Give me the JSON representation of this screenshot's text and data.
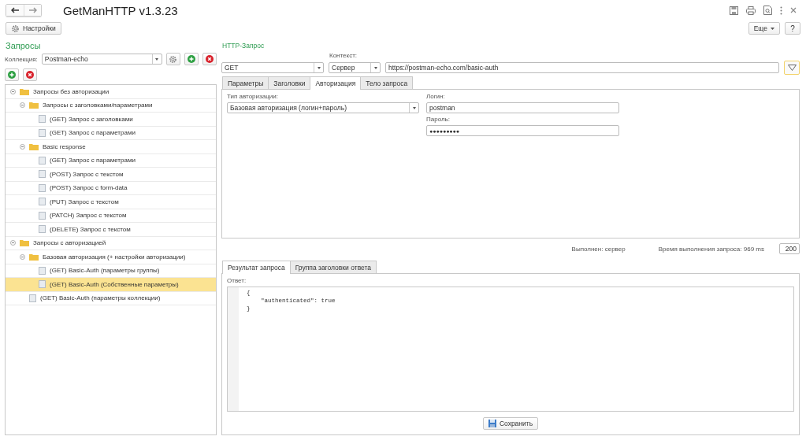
{
  "window": {
    "title": "GetManHTTP v1.3.23"
  },
  "toolbar": {
    "settings_button": "Настройки",
    "more_button": "Еще",
    "help_button": "?"
  },
  "left": {
    "title": "Запросы",
    "collection_label": "Коллекция:",
    "collection_value": "Postman-echo",
    "tree": [
      {
        "kind": "folder",
        "label": "Запросы без авторизации",
        "expanded": true,
        "selected": false,
        "children": [
          {
            "kind": "folder",
            "label": "Запросы с заголовками/параметрами",
            "expanded": true,
            "selected": false,
            "children": [
              {
                "kind": "request",
                "label": "(GET) Запрос с заголовками",
                "selected": false
              },
              {
                "kind": "request",
                "label": "(GET) Запрос с параметрами",
                "selected": false
              }
            ]
          },
          {
            "kind": "folder",
            "label": "Basic response",
            "expanded": true,
            "selected": false,
            "children": [
              {
                "kind": "request",
                "label": "(GET) Запрос с параметрами",
                "selected": false
              },
              {
                "kind": "request",
                "label": "(POST) Запрос с текстом",
                "selected": false
              },
              {
                "kind": "request",
                "label": "(POST) Запрос с form-data",
                "selected": false
              },
              {
                "kind": "request",
                "label": "(PUT) Запрос с текстом",
                "selected": false
              },
              {
                "kind": "request",
                "label": "(PATCH) Запрос с текстом",
                "selected": false
              },
              {
                "kind": "request",
                "label": "(DELETE) Запрос с текстом",
                "selected": false
              }
            ]
          }
        ]
      },
      {
        "kind": "folder",
        "label": "Запросы с авторизацией",
        "expanded": true,
        "selected": false,
        "children": [
          {
            "kind": "folder",
            "label": "Базовая авторизация (+ настройки авторизации)",
            "expanded": true,
            "selected": false,
            "children": [
              {
                "kind": "request",
                "label": "(GET) Basic-Auth (параметры группы)",
                "selected": false
              },
              {
                "kind": "request",
                "label": "(GET) Basic-Auth (Собственные параметры)",
                "selected": true
              }
            ]
          },
          {
            "kind": "request",
            "label": "(GET) Basic-Auth (параметры коллекции)",
            "selected": false
          }
        ]
      }
    ]
  },
  "request": {
    "title": "HTTP-Запрос",
    "method": "GET",
    "context_label": "Контекст:",
    "context": "Сервер",
    "url": "https://postman-echo.com/basic-auth",
    "tabs": [
      {
        "label": "Параметры",
        "selected": false
      },
      {
        "label": "Заголовки",
        "selected": false
      },
      {
        "label": "Авторизация",
        "selected": true
      },
      {
        "label": "Тело запроса",
        "selected": false
      }
    ],
    "auth_type_label": "Тип авторизации:",
    "auth_type": "Базовая авторизация (логин+пароль)",
    "login_label": "Логин:",
    "login": "postman",
    "password_label": "Пароль:",
    "password": "●●●●●●●●●"
  },
  "status": {
    "executed": "Выполнен: сервер",
    "time": "Время выполнения запроса: 969 ms",
    "code": "200"
  },
  "result": {
    "tabs": [
      {
        "label": "Результат запроса",
        "selected": true
      },
      {
        "label": "Группа заголовки ответа",
        "selected": false
      }
    ],
    "answer_label": "Ответ:",
    "lines": [
      "{",
      "    \"authenticated\": true",
      "}"
    ],
    "save_button": "Сохранить"
  }
}
